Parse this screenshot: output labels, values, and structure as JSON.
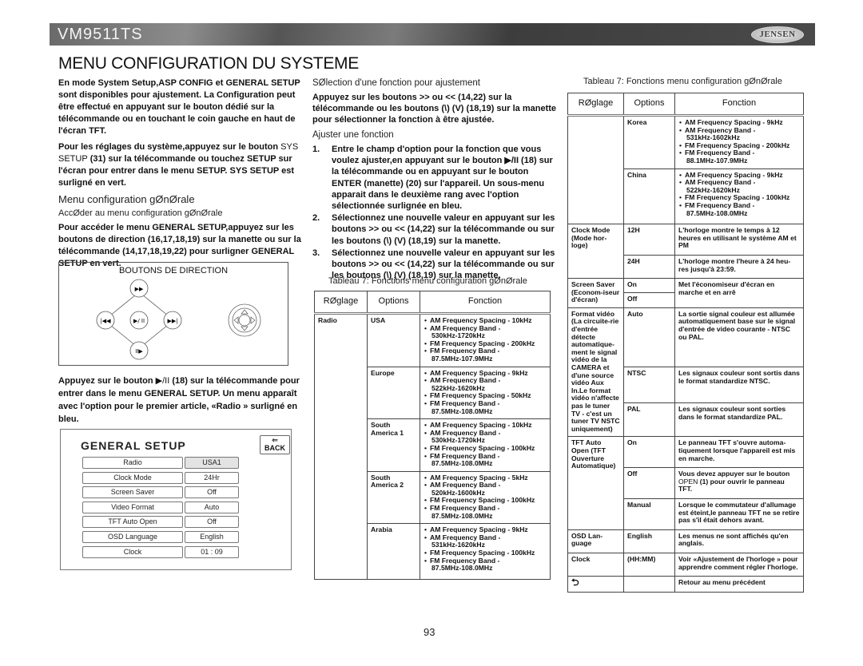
{
  "header": {
    "model": "VM9511TS",
    "brand": "JENSEN",
    "page_title": "MENU CONFIGURATION DU SYSTEME"
  },
  "col1": {
    "para1": "En mode System Setup,ASP CONFIG et GENERAL SETUP sont disponibles pour ajustement. La Configuration peut être effectué en appuyant sur le bouton dédié sur la télécommande ou en touchant le coin gauche en haut de l'écran TFT.",
    "para2_a": "Pour les réglages du système,appuyez sur le bouton ",
    "para2_b": "SYS SETUP",
    "para2_c": " (31) sur la télécommande ou touchez SETUP sur l'écran pour entrer dans le menu SETUP. SYS SETUP est surligné en vert.",
    "heading1": "Menu configuration gØnØrale",
    "heading2": "AccØder au menu configuration gØnØrale",
    "para3": "Pour accéder le menu GENERAL SETUP,appuyez sur les boutons de direction (16,17,18,19) sur la manette ou sur la télécommande (14,17,18,19,22) pour surligner GENERAL SETUP en vert.",
    "direction_box_title": "BOUTONS DE DIRECTION",
    "direction_buttons": {
      "up": "▶▶",
      "left": "|◀◀",
      "center": "▶/ II",
      "right": "▶▶|",
      "down": "II▶"
    },
    "para4_a": "Appuyez sur le bouton ",
    "para4_b": "▶/II",
    "para4_c": " (18) sur la télécommande pour entrer dans le menu GENERAL SETUP. Un menu apparaît avec l'option pour le premier article, «Radio » surligné en bleu."
  },
  "general_setup": {
    "title": "GENERAL SETUP",
    "back_label": "BACK",
    "back_arrow": "⇐",
    "rows": [
      {
        "label": "Radio",
        "value": "USA1",
        "selected": true
      },
      {
        "label": "Clock  Mode",
        "value": "24Hr",
        "selected": false
      },
      {
        "label": "Screen Saver",
        "value": "Off",
        "selected": false
      },
      {
        "label": "Video Format",
        "value": "Auto",
        "selected": false
      },
      {
        "label": "TFT Auto Open",
        "value": "Off",
        "selected": false
      },
      {
        "label": "OSD Language",
        "value": "English",
        "selected": false
      },
      {
        "label": "Clock",
        "value": "01  :  09",
        "selected": false
      }
    ]
  },
  "col2": {
    "heading1": "SØlection d'une fonction pour ajustement",
    "para1": "Appuyez sur les boutons >> ou << (14,22) sur la télécommande ou les boutons (\\) (V) (18,19) sur la manette pour sélectionner la fonction à être ajustée.",
    "heading2": "Ajuster une fonction",
    "steps": [
      {
        "num": "1.",
        "text": "Entre le champ d'option pour la fonction que vous voulez ajuster,en appuyant sur le bouton ▶/II (18) sur la télécommande ou en appuyant sur le bouton ENTER (manette) (20) sur l'appareil. Un sous-menu apparait dans le deuxième rang avec l'option sélectionnée surlignée en bleu."
      },
      {
        "num": "2.",
        "text": "Sélectionnez une nouvelle valeur en appuyant sur les boutons >> ou << (14,22) sur la télécommande ou sur les boutons (\\) (V) (18,19) sur la manette."
      },
      {
        "num": "3.",
        "text": "Sélectionnez une nouvelle valeur en appuyant sur les boutons >> ou << (14,22) sur la télécommande ou sur les boutons (\\) (V) (18,19) sur la manette."
      }
    ]
  },
  "table_left": {
    "caption": "Tableau 7: Fonctions menu configuration gØnØrale",
    "headers": [
      "RØglage",
      "Options",
      "Fonction"
    ],
    "setting": "Radio",
    "rows": [
      {
        "option": "USA",
        "items": [
          "AM Frequency Spacing - 10kHz",
          "AM Frequency Band -",
          "530kHz-1720kHz",
          "FM Frequency Spacing - 200kHz",
          "FM Frequency Band -",
          "87.5MHz-107.9MHz"
        ]
      },
      {
        "option": "Europe",
        "items": [
          "AM Frequency Spacing - 9kHz",
          "AM Frequency Band -",
          "522kHz-1620kHz",
          "FM Frequency Spacing - 50kHz",
          "FM Frequency Band -",
          "87.5MHz-108.0MHz"
        ]
      },
      {
        "option": "South America 1",
        "items": [
          "AM Frequency Spacing - 10kHz",
          "AM Frequency Band -",
          "530kHz-1720kHz",
          "FM Frequency Spacing - 100kHz",
          "FM Frequency Band -",
          "87.5MHz-108.0MHz"
        ]
      },
      {
        "option": "South America 2",
        "items": [
          "AM Frequency Spacing - 5kHz",
          "AM Frequency Band -",
          "520kHz-1600kHz",
          "FM Frequency Spacing - 100kHz",
          "FM Frequency Band -",
          "87.5MHz-108.0MHz"
        ]
      },
      {
        "option": "Arabia",
        "items": [
          "AM Frequency Spacing - 9kHz",
          "AM Frequency Band -",
          "531kHz-1620kHz",
          "FM Frequency Spacing - 100kHz",
          "FM Frequency Band -",
          "87.5MHz-108.0MHz"
        ]
      }
    ]
  },
  "table_right": {
    "caption": "Tableau 7: Fonctions menu configuration gØnØrale",
    "headers": [
      "RØglage",
      "Options",
      "Fonction"
    ],
    "radio_rows": [
      {
        "option": "Korea",
        "items": [
          "AM Frequency Spacing - 9kHz",
          "AM Frequency Band -",
          "531kHz-1602kHz",
          "FM Frequency Spacing - 200kHz",
          "FM Frequency Band -",
          "88.1MHz-107.9MHz"
        ]
      },
      {
        "option": "China",
        "items": [
          "AM Frequency Spacing - 9kHz",
          "AM Frequency Band -",
          "522kHz-1620kHz",
          "FM Frequency Spacing - 100kHz",
          "FM Frequency Band -",
          "87.5MHz-108.0MHz"
        ]
      }
    ],
    "clock_mode": {
      "setting": "Clock Mode (Mode hor-loge)",
      "opt1": "12H",
      "fn1": "L'horloge montre le temps à 12 heures en utilisant le système AM et PM",
      "opt2": "24H",
      "fn2": "L'horloge montre l'heure à 24 heu-res jusqu'à 23:59."
    },
    "screen_saver": {
      "setting": "Screen Saver (Econom-iseur d'écran)",
      "opt1": "On",
      "opt2": "Off",
      "fn": "Met l'économiseur d'écran en marche et en arrê"
    },
    "video_format": {
      "setting": "Format vidéo (La circuite-rie d'entrée détecte automatique-ment le signal vidéo de la CAMERA et d'une source vidéo Aux In.Le format vidéo n'affecte pas le tuner TV - c'est un tuner TV NSTC uniquement)",
      "opt1": "Auto",
      "fn1": "La sortie signal couleur est allumée automatiquement base sur le signal d'entrée de video courante - NTSC ou PAL.",
      "opt2": "NTSC",
      "fn2": "Les signaux couleur sont sortis dans le format standardize NTSC.",
      "opt3": "PAL",
      "fn3": "Les signaux couleur sont sorties dans le format standardize PAL."
    },
    "tft_auto_open": {
      "setting": "TFT Auto Open (TFT Ouverture Automatique)",
      "opt1": "On",
      "fn1": "Le panneau TFT s'ouvre automa-tiquement lorsque l'appareil est mis en marche.",
      "opt2": "Off",
      "fn2_a": "Vous devez appuyer sur le bouton ",
      "fn2_b": "OPEN",
      "fn2_c": " (1) pour ouvrir le panneau TFT.",
      "opt3": "Manual",
      "fn3": "Lorsque le commutateur d'allumage est éteint,le panneau TFT ne se retire pas  s'il était dehors avant."
    },
    "osd_language": {
      "setting": "OSD Lan-guage",
      "opt": "English",
      "fn": "Les menus ne sont affichés qu'en anglais."
    },
    "clock": {
      "setting": "Clock",
      "opt": "(HH:MM)",
      "fn": "Voir «Ajustement de l'horloge » pour apprendre comment régler l'horloge."
    },
    "back": {
      "icon": "⮌",
      "fn": "Retour au menu précédent"
    }
  },
  "footer": {
    "page_number": "93"
  }
}
